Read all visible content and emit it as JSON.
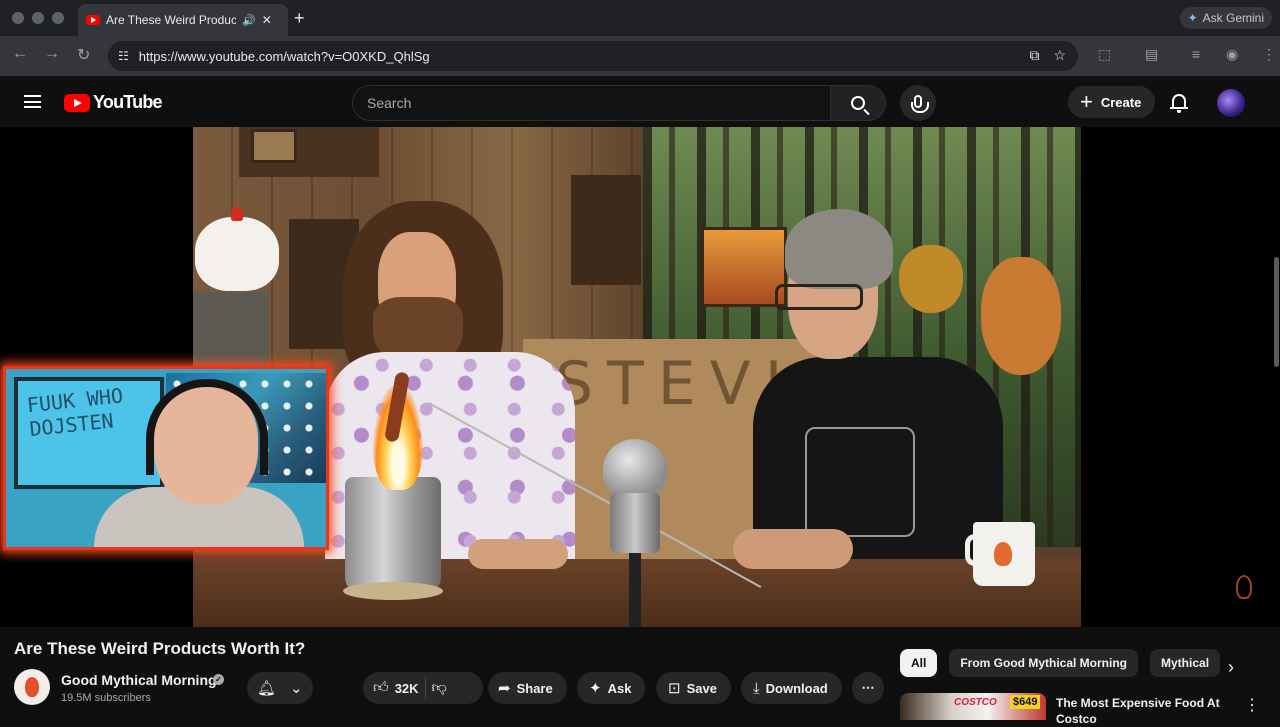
{
  "browser": {
    "tab_title": "Are These Weird Products Worth It?",
    "tab_audio_icon": "speaker-icon",
    "tab_close": "✕",
    "new_tab": "+",
    "url": "https://www.youtube.com/watch?v=O0XKD_QhlSg",
    "ask_gemini": "Ask Gemini"
  },
  "youtube": {
    "logo_text": "YouTube",
    "search_placeholder": "Search",
    "create_label": "Create"
  },
  "video": {
    "title": "Are These Weird Products Worth It?",
    "box_scrawl": "STEVIE",
    "pip_scrawl": "FUUK WHO DOJSTEN"
  },
  "channel": {
    "name": "Good Mythical Morning",
    "subscribers": "19.5M subscribers"
  },
  "actions": {
    "likes": "32K",
    "share": "Share",
    "ask": "Ask",
    "save": "Save",
    "download": "Download",
    "more": "⋯"
  },
  "chips": [
    "All",
    "From Good Mythical Morning",
    "Mythical"
  ],
  "recommended": {
    "title": "The Most Expensive Food At Costco",
    "thumb_brand": "COSTCO",
    "thumb_price": "$649"
  },
  "colors": {
    "youtube_red": "#ff0000",
    "pip_border": "#e8361c",
    "background": "#0f0f0f"
  }
}
